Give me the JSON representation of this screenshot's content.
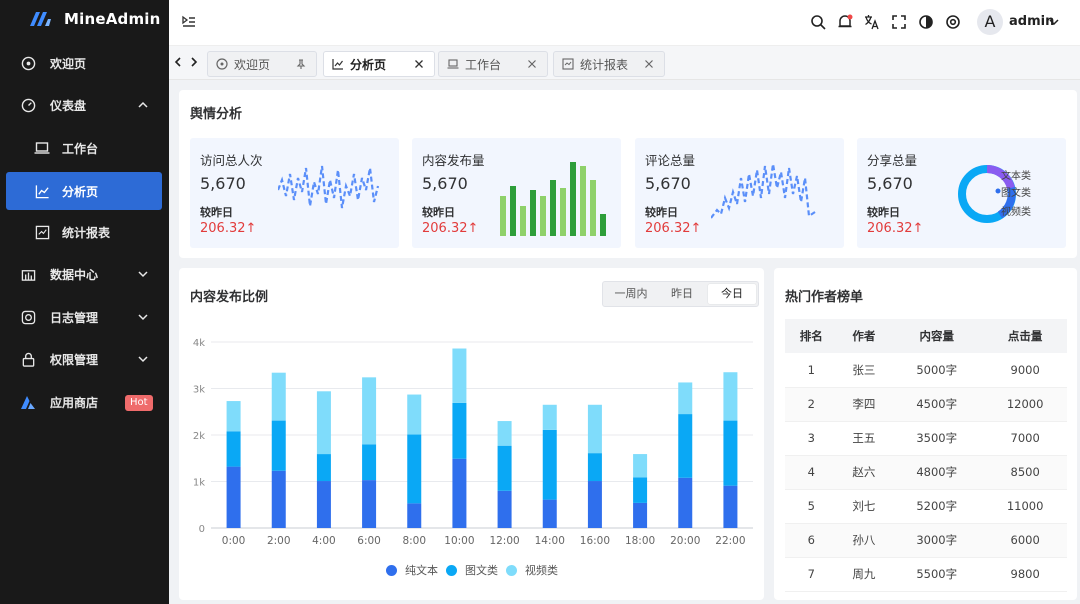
{
  "app": {
    "name": "MineAdmin"
  },
  "sidebar": {
    "items": [
      {
        "label": "欢迎页"
      },
      {
        "label": "仪表盘"
      },
      {
        "label": "工作台"
      },
      {
        "label": "分析页"
      },
      {
        "label": "统计报表"
      },
      {
        "label": "数据中心"
      },
      {
        "label": "日志管理"
      },
      {
        "label": "权限管理"
      },
      {
        "label": "应用商店",
        "badge": "Hot"
      }
    ]
  },
  "header": {
    "user": "admin",
    "avatar_letter": "A"
  },
  "tabs": [
    {
      "label": "欢迎页"
    },
    {
      "label": "分析页"
    },
    {
      "label": "工作台"
    },
    {
      "label": "统计报表"
    }
  ],
  "overview": {
    "title": "舆情分析",
    "stats": [
      {
        "title": "访问总人次",
        "value": "5,670",
        "compare": "较昨日",
        "change": "206.32↑"
      },
      {
        "title": "内容发布量",
        "value": "5,670",
        "compare": "较昨日",
        "change": "206.32↑"
      },
      {
        "title": "评论总量",
        "value": "5,670",
        "compare": "较昨日",
        "change": "206.32↑"
      },
      {
        "title": "分享总量",
        "value": "5,670",
        "compare": "较昨日",
        "change": "206.32↑"
      }
    ],
    "share_legend": [
      "文本类",
      "图文类",
      "视频类"
    ]
  },
  "publish": {
    "title": "内容发布比例",
    "ranges": [
      "一周内",
      "昨日",
      "今日"
    ],
    "selected_range": "今日"
  },
  "chart_data": {
    "type": "bar",
    "stacked": true,
    "categories": [
      "0:00",
      "2:00",
      "4:00",
      "6:00",
      "8:00",
      "10:00",
      "12:00",
      "14:00",
      "16:00",
      "18:00",
      "20:00",
      "22:00"
    ],
    "series": [
      {
        "name": "纯文本",
        "color": "#2f6fed",
        "values": [
          1320,
          1230,
          1010,
          1030,
          530,
          1490,
          800,
          610,
          1010,
          540,
          1080,
          910
        ]
      },
      {
        "name": "图文类",
        "color": "#0aa8f5",
        "values": [
          760,
          1080,
          580,
          770,
          1480,
          1200,
          970,
          1500,
          600,
          550,
          1370,
          1400
        ]
      },
      {
        "name": "视频类",
        "color": "#7fdcfb",
        "values": [
          650,
          1030,
          1350,
          1440,
          860,
          1170,
          530,
          540,
          1040,
          500,
          680,
          1040
        ]
      }
    ],
    "y_ticks": [
      "0",
      "1k",
      "2k",
      "3k",
      "4k"
    ],
    "ylim": [
      0,
      4000
    ],
    "legend_position": "bottom"
  },
  "ranking": {
    "title": "热门作者榜单",
    "columns": [
      "排名",
      "作者",
      "内容量",
      "点击量"
    ],
    "rows": [
      [
        "1",
        "张三",
        "5000字",
        "9000"
      ],
      [
        "2",
        "李四",
        "4500字",
        "12000"
      ],
      [
        "3",
        "王五",
        "3500字",
        "7000"
      ],
      [
        "4",
        "赵六",
        "4800字",
        "8500"
      ],
      [
        "5",
        "刘七",
        "5200字",
        "11000"
      ],
      [
        "6",
        "孙八",
        "3000字",
        "6000"
      ],
      [
        "7",
        "周九",
        "5500字",
        "9800"
      ]
    ]
  }
}
